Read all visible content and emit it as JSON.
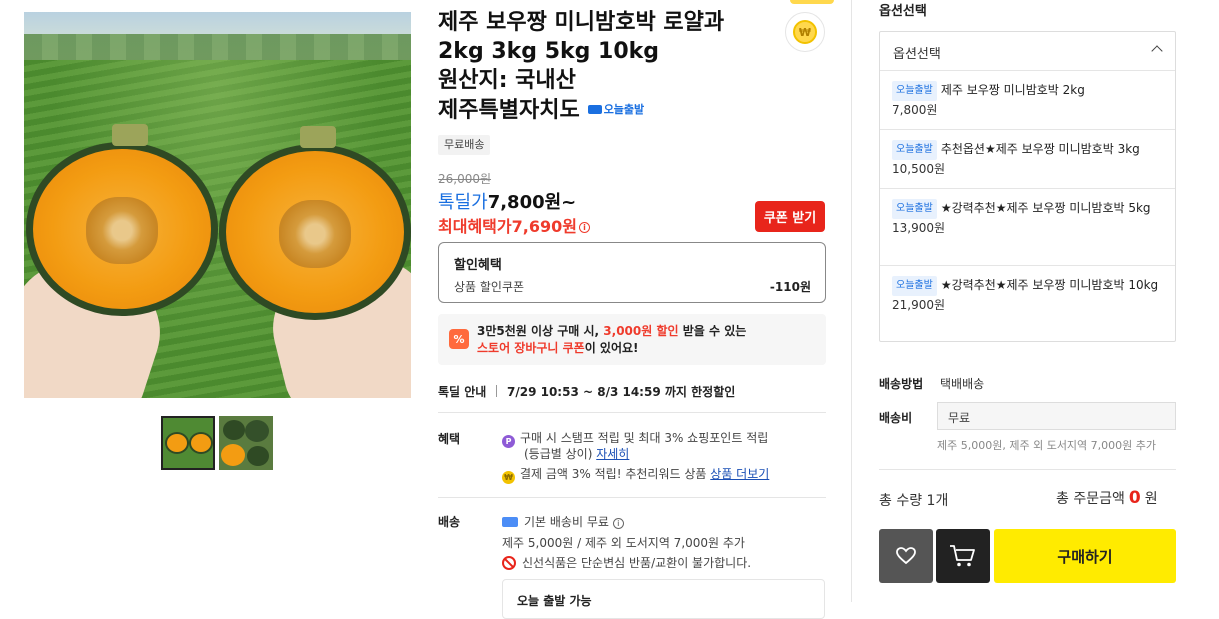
{
  "product": {
    "title_line1": "제주 보우짱 미니밤호박 로얄과",
    "title_line2": "2kg 3kg 5kg 10kg",
    "title_line3": "원산지: 국내산",
    "title_line4": "제주특별자치도",
    "today_badge": "오늘출발",
    "free_shipping_chip": "무료배송",
    "original_price": "26,000원",
    "deal_label": "톡딜가",
    "deal_price": "7,800원~",
    "max_benefit_label": "최대혜택가",
    "max_benefit_price": "7,690원",
    "coupon_button": "쿠폰 받기",
    "point_coin": "₩"
  },
  "discount": {
    "header": "할인혜택",
    "item_label": "상품 할인쿠폰",
    "item_value": "-110원"
  },
  "cart_banner": {
    "icon": "%",
    "line1_a": "3만5천원 이상 구매 시, ",
    "line1_red": "3,000원 할인",
    "line1_b": " 받을 수 있는",
    "line2_red": "스토어 장바구니 쿠폰",
    "line2_b": "이 있어요!"
  },
  "deal_info": {
    "label": "톡딜 안내",
    "text": "7/29 10:53 ~ 8/3 14:59 까지 한정할인"
  },
  "benefits": {
    "label": "혜택",
    "line1": "구매 시 스탬프 적립 및 최대 3% 쇼핑포인트 적립",
    "line2": "(등급별 상이)",
    "line2_link": "자세히",
    "line3": "결제 금액 3% 적립! 추천리워드 상품",
    "line3_link": "상품 더보기"
  },
  "shipping": {
    "label": "배송",
    "line1": "기본 배송비 무료",
    "line2": "제주 5,000원 / 제주 외 도서지역 7,000원 추가",
    "line3": "신선식품은 단순변심 반품/교환이 불가합니다.",
    "today_box": "오늘 출발 가능"
  },
  "options": {
    "section_title": "옵션선택",
    "dropdown_label": "옵션선택",
    "items": [
      {
        "badge": "오늘출발",
        "name": "제주 보우짱 미니밤호박 2kg",
        "price": "7,800원"
      },
      {
        "badge": "오늘출발",
        "name": "추천옵션★제주 보우짱 미니밤호박 3kg",
        "price": "10,500원"
      },
      {
        "badge": "오늘출발",
        "name": "★강력추천★제주 보우짱 미니밤호박 5kg",
        "price": "13,900원"
      },
      {
        "badge": "오늘출발",
        "name": "★강력추천★제주 보우짱 미니밤호박 10kg",
        "price": "21,900원"
      }
    ]
  },
  "delivery": {
    "method_label": "배송방법",
    "method_value": "택배배송",
    "fee_label": "배송비",
    "fee_value": "무료",
    "fee_note": "제주 5,000원, 제주 외 도서지역 7,000원 추가"
  },
  "summary": {
    "qty_label": "총 수량 1개",
    "total_label": "총 주문금액",
    "total_amount": "0",
    "total_unit": "원"
  },
  "actions": {
    "buy_button": "구매하기"
  },
  "colors": {
    "accent_red": "#e8251b",
    "deal_blue": "#1a6fe0",
    "buy_yellow": "#ffeb00"
  }
}
